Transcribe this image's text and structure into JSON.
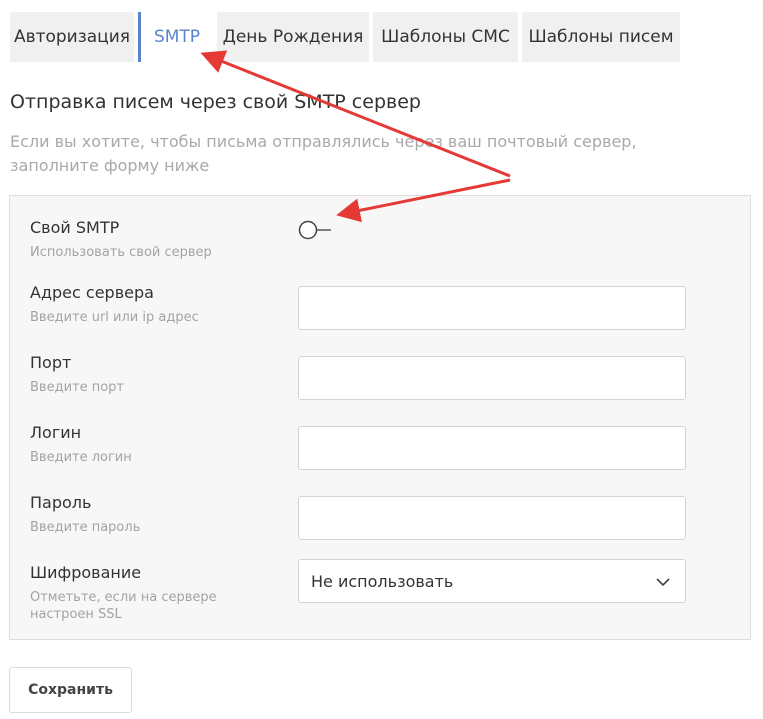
{
  "tabs": [
    {
      "label": "Авторизация",
      "active": false
    },
    {
      "label": "SMTP",
      "active": true
    },
    {
      "label": "День Рождения",
      "active": false
    },
    {
      "label": "Шаблоны СМС",
      "active": false
    },
    {
      "label": "Шаблоны писем",
      "active": false
    }
  ],
  "section": {
    "title": "Отправка писем через свой SMTP сервер",
    "description": "Если вы хотите, чтобы письма отправлялись через ваш почтовый сервер, заполните форму ниже"
  },
  "form": {
    "smtp": {
      "label": "Свой SMTP",
      "hint": "Использовать свой сервер",
      "enabled": false
    },
    "server": {
      "label": "Адрес сервера",
      "hint": "Введите url или ip адрес",
      "value": ""
    },
    "port": {
      "label": "Порт",
      "hint": "Введите порт",
      "value": ""
    },
    "login": {
      "label": "Логин",
      "hint": "Введите логин",
      "value": ""
    },
    "password": {
      "label": "Пароль",
      "hint": "Введите пароль",
      "value": ""
    },
    "encryption": {
      "label": "Шифрование",
      "hint_line1": "Отметьте, если на сервере",
      "hint_line2": "настроен SSL",
      "selected": "Не использовать"
    }
  },
  "actions": {
    "save_label": "Сохранить"
  },
  "colors": {
    "accent": "#5a84c9",
    "annotation_arrow": "#e53935"
  },
  "icons": {
    "select_arrow": "chevron-down-icon",
    "toggle": "toggle-switch-icon"
  }
}
